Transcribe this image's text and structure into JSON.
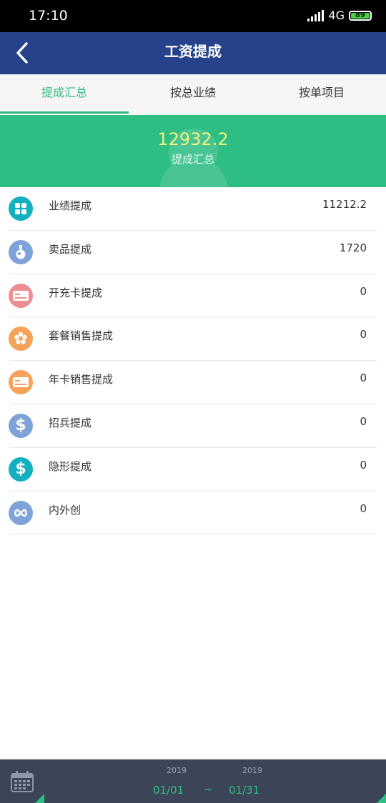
{
  "status_bar": {
    "time": "17:10",
    "network": "4G",
    "battery": "89"
  },
  "header": {
    "title": "工资提成"
  },
  "tabs": [
    {
      "label": "提成汇总",
      "active": true
    },
    {
      "label": "按总业绩",
      "active": false
    },
    {
      "label": "按单项目",
      "active": false
    }
  ],
  "summary": {
    "value": "12932.2",
    "label": "提成汇总"
  },
  "items": [
    {
      "label": "业绩提成",
      "value": "11212.2",
      "icon": "grid-icon",
      "color": "#13b1c0"
    },
    {
      "label": "卖品提成",
      "value": "1720",
      "icon": "potion-icon",
      "color": "#7fa3d9"
    },
    {
      "label": "开充卡提成",
      "value": "0",
      "icon": "card-icon",
      "color": "#ee8e92"
    },
    {
      "label": "套餐销售提成",
      "value": "0",
      "icon": "flower-icon",
      "color": "#f7a25b"
    },
    {
      "label": "年卡销售提成",
      "value": "0",
      "icon": "card-icon",
      "color": "#f7a25b"
    },
    {
      "label": "招兵提成",
      "value": "0",
      "icon": "dollar-icon",
      "color": "#7fa3d9"
    },
    {
      "label": "隐形提成",
      "value": "0",
      "icon": "dollar-icon",
      "color": "#13b1c0"
    },
    {
      "label": "内外创",
      "value": "0",
      "icon": "infinity-icon",
      "color": "#7fa3d9"
    }
  ],
  "date_range": {
    "start_year": "2019",
    "start_md": "01/01",
    "separator": "~",
    "end_year": "2019",
    "end_md": "01/31"
  }
}
